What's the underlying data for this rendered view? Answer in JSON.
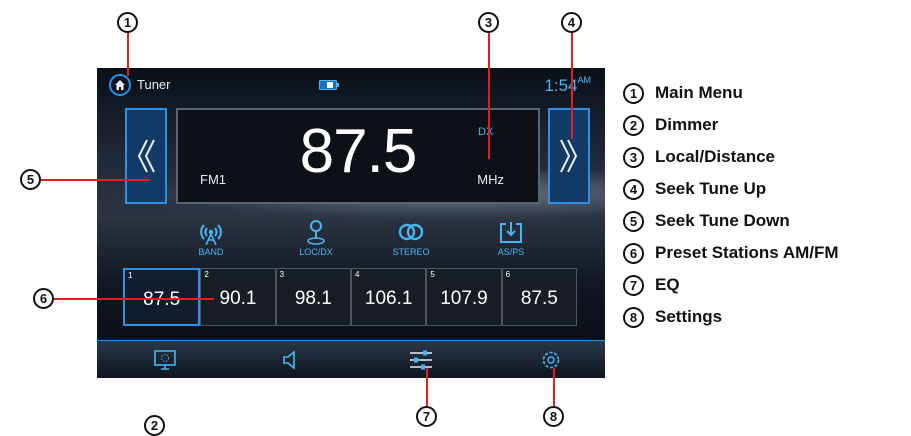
{
  "screen": {
    "tuner_label": "Tuner",
    "clock_time": "1:54",
    "clock_ampm": "AM",
    "frequency": "87.5",
    "band": "FM1",
    "unit": "MHz",
    "dx_indicator": "DX",
    "functions": [
      {
        "label": "BAND",
        "icon": "antenna-icon"
      },
      {
        "label": "LOC/DX",
        "icon": "location-pin-icon"
      },
      {
        "label": "STEREO",
        "icon": "stereo-rings-icon"
      },
      {
        "label": "AS/PS",
        "icon": "auto-store-icon"
      }
    ],
    "presets": [
      {
        "num": "1",
        "value": "87.5",
        "active": true
      },
      {
        "num": "2",
        "value": "90.1",
        "active": false
      },
      {
        "num": "3",
        "value": "98.1",
        "active": false
      },
      {
        "num": "4",
        "value": "106.1",
        "active": false
      },
      {
        "num": "5",
        "value": "107.9",
        "active": false
      },
      {
        "num": "6",
        "value": "87.5",
        "active": false
      }
    ],
    "bottom_icons": [
      "dimmer-icon",
      "speaker-icon",
      "eq-sliders-icon",
      "settings-gear-icon"
    ],
    "accent_color": "#2f8fe0",
    "label_color": "#49b4f0"
  },
  "callouts": [
    "1",
    "2",
    "3",
    "4",
    "5",
    "6",
    "7",
    "8"
  ],
  "legend": [
    {
      "num": "1",
      "text": "Main Menu"
    },
    {
      "num": "2",
      "text": "Dimmer"
    },
    {
      "num": "3",
      "text": "Local/Distance"
    },
    {
      "num": "4",
      "text": "Seek Tune Up"
    },
    {
      "num": "5",
      "text": "Seek Tune Down"
    },
    {
      "num": "6",
      "text": "Preset Stations AM/FM"
    },
    {
      "num": "7",
      "text": "EQ"
    },
    {
      "num": "8",
      "text": "Settings"
    }
  ]
}
